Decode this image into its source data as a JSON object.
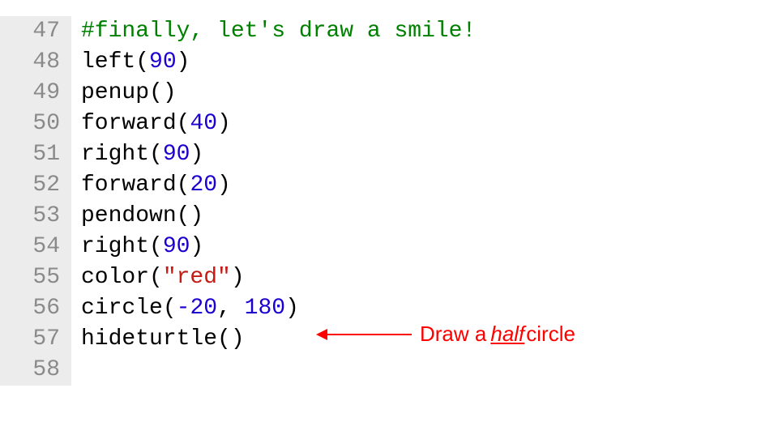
{
  "editor": {
    "lines": [
      {
        "lineno": "47",
        "tokens": [
          {
            "cls": "tok-comment",
            "text": "#finally, let's draw a smile!"
          }
        ]
      },
      {
        "lineno": "48",
        "tokens": [
          {
            "cls": "tok-default",
            "text": "left"
          },
          {
            "cls": "tok-paren",
            "text": "("
          },
          {
            "cls": "tok-number",
            "text": "90"
          },
          {
            "cls": "tok-paren",
            "text": ")"
          }
        ]
      },
      {
        "lineno": "49",
        "tokens": [
          {
            "cls": "tok-default",
            "text": "penup"
          },
          {
            "cls": "tok-paren",
            "text": "()"
          }
        ]
      },
      {
        "lineno": "50",
        "tokens": [
          {
            "cls": "tok-default",
            "text": "forward"
          },
          {
            "cls": "tok-paren",
            "text": "("
          },
          {
            "cls": "tok-number",
            "text": "40"
          },
          {
            "cls": "tok-paren",
            "text": ")"
          }
        ]
      },
      {
        "lineno": "51",
        "tokens": [
          {
            "cls": "tok-default",
            "text": "right"
          },
          {
            "cls": "tok-paren",
            "text": "("
          },
          {
            "cls": "tok-number",
            "text": "90"
          },
          {
            "cls": "tok-paren",
            "text": ")"
          }
        ]
      },
      {
        "lineno": "52",
        "tokens": [
          {
            "cls": "tok-default",
            "text": "forward"
          },
          {
            "cls": "tok-paren",
            "text": "("
          },
          {
            "cls": "tok-number",
            "text": "20"
          },
          {
            "cls": "tok-paren",
            "text": ")"
          }
        ]
      },
      {
        "lineno": "53",
        "tokens": [
          {
            "cls": "tok-default",
            "text": "pendown"
          },
          {
            "cls": "tok-paren",
            "text": "()"
          }
        ]
      },
      {
        "lineno": "54",
        "tokens": [
          {
            "cls": "tok-default",
            "text": "right"
          },
          {
            "cls": "tok-paren",
            "text": "("
          },
          {
            "cls": "tok-number",
            "text": "90"
          },
          {
            "cls": "tok-paren",
            "text": ")"
          }
        ]
      },
      {
        "lineno": "55",
        "tokens": [
          {
            "cls": "tok-default",
            "text": "color"
          },
          {
            "cls": "tok-paren",
            "text": "("
          },
          {
            "cls": "tok-string",
            "text": "\"red\""
          },
          {
            "cls": "tok-paren",
            "text": ")"
          }
        ]
      },
      {
        "lineno": "56",
        "tokens": [
          {
            "cls": "tok-default",
            "text": "circle"
          },
          {
            "cls": "tok-paren",
            "text": "("
          },
          {
            "cls": "tok-number",
            "text": "-20"
          },
          {
            "cls": "tok-default",
            "text": ", "
          },
          {
            "cls": "tok-number",
            "text": "180"
          },
          {
            "cls": "tok-paren",
            "text": ")"
          }
        ]
      },
      {
        "lineno": "57",
        "tokens": [
          {
            "cls": "tok-default",
            "text": "hideturtle"
          },
          {
            "cls": "tok-paren",
            "text": "()"
          }
        ]
      },
      {
        "lineno": "58",
        "tokens": [
          {
            "cls": "tok-default",
            "text": ""
          }
        ]
      }
    ]
  },
  "annotation": {
    "prefix": "Draw a",
    "emph": "half",
    "suffix": "circle",
    "top_px": "375",
    "left_px": "392"
  },
  "colors": {
    "comment": "#008000",
    "number": "#1c00cf",
    "string": "#c41a16",
    "annotation": "#ff0000",
    "lineno_bg": "#ececec",
    "lineno_fg": "#8a8a8a"
  }
}
